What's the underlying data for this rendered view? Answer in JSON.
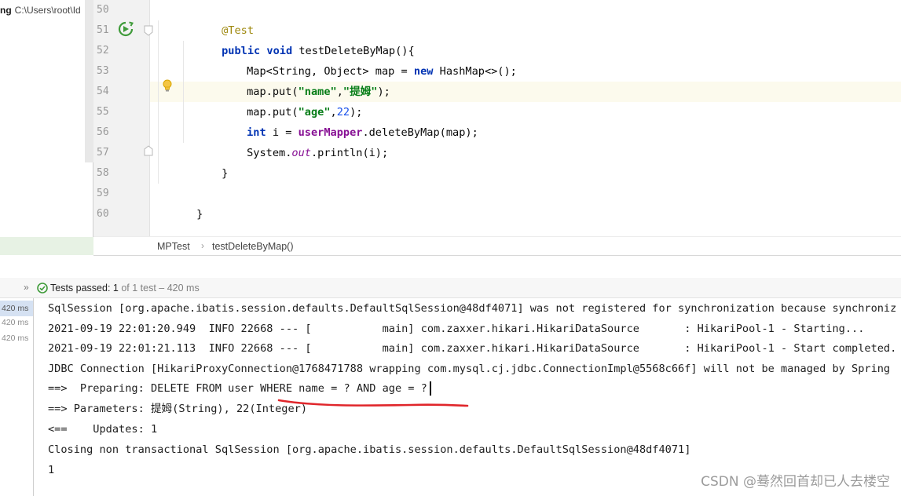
{
  "project": {
    "label_bold": "ng",
    "path": "C:\\Users\\root\\Id"
  },
  "editor": {
    "line_numbers": [
      "50",
      "51",
      "52",
      "53",
      "54",
      "55",
      "56",
      "57",
      "58",
      "59",
      "60"
    ],
    "current_line": "54",
    "code": {
      "l50": {
        "annotation": "@Test"
      },
      "l51": {
        "kw_public": "public",
        "kw_void": "void",
        "method": " testDeleteByMap(){"
      },
      "l52": {
        "pre": "Map<String, Object> map = ",
        "kw_new": "new",
        "post": " HashMap<>();"
      },
      "l53": {
        "pre": "map.put(",
        "s1": "\"name\"",
        "comma": ",",
        "s2": "\"提姆\"",
        "post": ");"
      },
      "l54": {
        "pre": "map.put(",
        "s1": "\"age\"",
        "comma": ",",
        "n1": "22",
        "post": ");"
      },
      "l55": {
        "kw_int": "int",
        "pre": " i = ",
        "field": "userMapper",
        "post": ".deleteByMap(map);"
      },
      "l56": {
        "pre": "System.",
        "static": "out",
        "post": ".println(i);"
      },
      "l57": {
        "text": "}"
      },
      "l59": {
        "text": "}"
      }
    }
  },
  "breadcrumb": {
    "items": [
      "MPTest",
      "testDeleteByMap()"
    ],
    "separator": "›"
  },
  "run": {
    "chevron": "»",
    "status_label": "Tests passed:",
    "status_count": "1",
    "status_rest": "of 1 test – 420 ms"
  },
  "test_tree": {
    "durations": [
      "420 ms",
      "420 ms",
      "420 ms"
    ]
  },
  "console": {
    "lines": [
      "SqlSession [org.apache.ibatis.session.defaults.DefaultSqlSession@48df4071] was not registered for synchronization because synchroniz",
      "2021-09-19 22:01:20.949  INFO 22668 --- [           main] com.zaxxer.hikari.HikariDataSource       : HikariPool-1 - Starting...",
      "2021-09-19 22:01:21.113  INFO 22668 --- [           main] com.zaxxer.hikari.HikariDataSource       : HikariPool-1 - Start completed.",
      "JDBC Connection [HikariProxyConnection@1768471788 wrapping com.mysql.cj.jdbc.ConnectionImpl@5568c66f] will not be managed by Spring",
      "==>  Preparing: DELETE FROM user WHERE name = ? AND age = ?",
      "==> Parameters: 提姆(String), 22(Integer)",
      "<==    Updates: 1",
      "Closing non transactional SqlSession [org.apache.ibatis.session.defaults.DefaultSqlSession@48df4071]",
      "1"
    ]
  },
  "watermark": "CSDN @蓦然回首却已人去楼空",
  "colors": {
    "keyword": "#0033b3",
    "string": "#067d17",
    "annotation": "#9e880d",
    "number": "#1750eb",
    "field": "#871094",
    "pass_green": "#3f9b3a",
    "underline_red": "#e0262b"
  }
}
